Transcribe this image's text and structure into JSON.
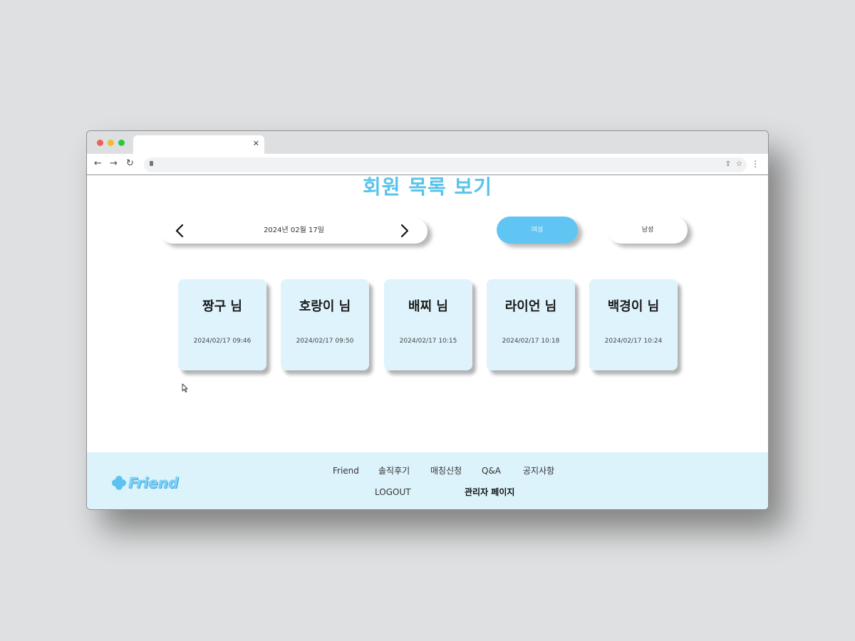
{
  "page": {
    "title": "회원 목록 보기"
  },
  "date_nav": {
    "date": "2024년 02월 17일"
  },
  "gender_filter": {
    "female_label": "여성",
    "male_label": "남성"
  },
  "members": [
    {
      "name": "짱구 님",
      "time": "2024/02/17  09:46"
    },
    {
      "name": "호랑이 님",
      "time": "2024/02/17  09:50"
    },
    {
      "name": "배찌 님",
      "time": "2024/02/17  10:15"
    },
    {
      "name": "라이언 님",
      "time": "2024/02/17  10:18"
    },
    {
      "name": "백경이 님",
      "time": "2024/02/17  10:24"
    }
  ],
  "footer": {
    "logo_text": "Friend",
    "nav": [
      "Friend",
      "솔직후기",
      "매칭신청",
      "Q&A",
      "공지사항"
    ],
    "logout": "LOGOUT",
    "admin": "관리자 페이지"
  },
  "colors": {
    "accent": "#58c3ea",
    "card_bg": "#dff3fd",
    "footer_bg": "#dcf3fc",
    "female_button": "#61c5f3"
  }
}
